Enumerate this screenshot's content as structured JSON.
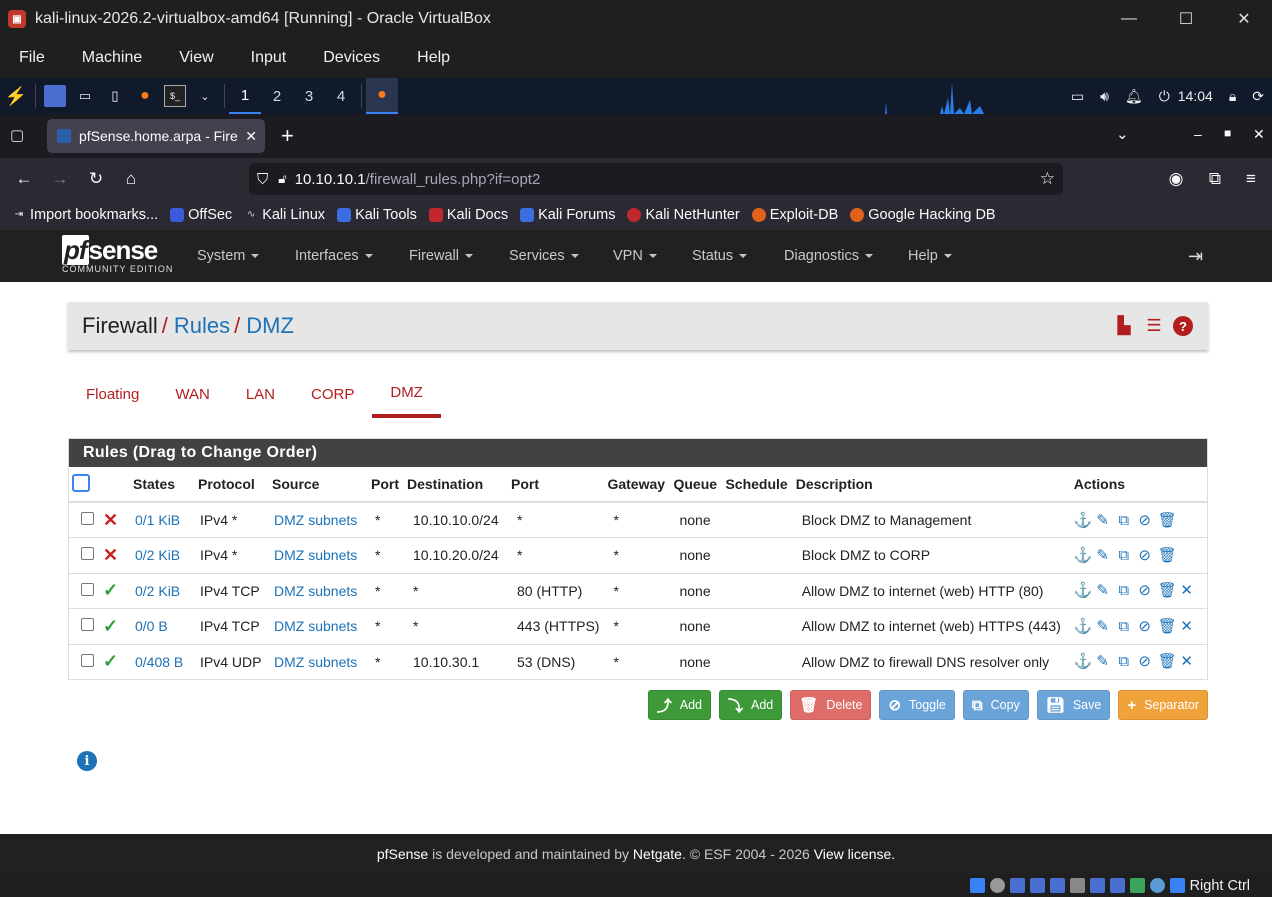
{
  "vbox": {
    "title": "kali-linux-2026.2-virtualbox-amd64 [Running] - Oracle VirtualBox",
    "menu": [
      "File",
      "Machine",
      "View",
      "Input",
      "Devices",
      "Help"
    ],
    "status_host_key": "Right Ctrl"
  },
  "kali": {
    "workspaces": [
      "1",
      "2",
      "3",
      "4"
    ],
    "time": "14:04"
  },
  "browser": {
    "tab_title": "pfSense.home.arpa - Fire",
    "url_host": "10.10.10.1",
    "url_path": "/firewall_rules.php?if=opt2",
    "bookmarks": [
      "Import bookmarks...",
      "OffSec",
      "Kali Linux",
      "Kali Tools",
      "Kali Docs",
      "Kali Forums",
      "Kali NetHunter",
      "Exploit-DB",
      "Google Hacking DB"
    ]
  },
  "pfsense": {
    "logo_text": "sense",
    "logo_pf": "pf",
    "logo_sub": "COMMUNITY EDITION",
    "menu": [
      "System",
      "Interfaces",
      "Firewall",
      "Services",
      "VPN",
      "Status",
      "Diagnostics",
      "Help"
    ],
    "breadcrumb": {
      "root": "Firewall",
      "level1": "Rules",
      "level2": "DMZ"
    },
    "if_tabs": [
      "Floating",
      "WAN",
      "LAN",
      "CORP",
      "DMZ"
    ],
    "active_tab": "DMZ",
    "panel_title": "Rules (Drag to Change Order)",
    "columns": [
      "",
      "",
      "States",
      "Protocol",
      "Source",
      "Port",
      "Destination",
      "Port",
      "Gateway",
      "Queue",
      "Schedule",
      "Description",
      "Actions"
    ],
    "rules": [
      {
        "status": "block",
        "states": "0/1 KiB",
        "protocol": "IPv4 *",
        "source": "DMZ subnets",
        "sport": "*",
        "destination": "10.10.10.0/24",
        "dport": "*",
        "gateway": "*",
        "queue": "none",
        "schedule": "",
        "description": "Block DMZ to Management",
        "can_delete_x": false
      },
      {
        "status": "block",
        "states": "0/2 KiB",
        "protocol": "IPv4 *",
        "source": "DMZ subnets",
        "sport": "*",
        "destination": "10.10.20.0/24",
        "dport": "*",
        "gateway": "*",
        "queue": "none",
        "schedule": "",
        "description": "Block DMZ to CORP",
        "can_delete_x": false
      },
      {
        "status": "pass",
        "states": "0/2 KiB",
        "protocol": "IPv4 TCP",
        "source": "DMZ subnets",
        "sport": "*",
        "destination": "*",
        "dport": "80 (HTTP)",
        "gateway": "*",
        "queue": "none",
        "schedule": "",
        "description": "Allow DMZ to internet (web) HTTP (80)",
        "can_delete_x": true
      },
      {
        "status": "pass",
        "states": "0/0 B",
        "protocol": "IPv4 TCP",
        "source": "DMZ subnets",
        "sport": "*",
        "destination": "*",
        "dport": "443 (HTTPS)",
        "gateway": "*",
        "queue": "none",
        "schedule": "",
        "description": "Allow DMZ to internet (web) HTTPS (443)",
        "can_delete_x": true
      },
      {
        "status": "pass",
        "states": "0/408 B",
        "protocol": "IPv4 UDP",
        "source": "DMZ subnets",
        "sport": "*",
        "destination": "10.10.30.1",
        "dport": "53 (DNS)",
        "gateway": "*",
        "queue": "none",
        "schedule": "",
        "description": "Allow DMZ to firewall DNS resolver only",
        "can_delete_x": true
      }
    ],
    "buttons": {
      "add_top": "Add",
      "add_bottom": "Add",
      "delete": "Delete",
      "toggle": "Toggle",
      "copy": "Copy",
      "save": "Save",
      "separator": "Separator"
    },
    "footer": {
      "brand": "pfSense",
      "text1": " is developed and maintained by ",
      "company": "Netgate",
      "text2": ". © ESF 2004 - 2026 ",
      "license": "View license."
    }
  },
  "colors": {
    "pf_red": "#b21e1e",
    "pf_link": "#1d72b8",
    "pf_dark": "#212121",
    "pass_green": "#2e9e3e",
    "block_red": "#c82121"
  }
}
